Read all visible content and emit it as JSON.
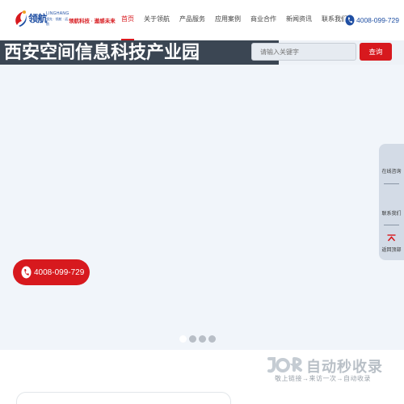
{
  "brand": {
    "name": "领航",
    "en": "LINGHANG",
    "sub": "领先 · 领航 · 远航",
    "slogan": "领航科技 · 遨感未来"
  },
  "nav": {
    "items": [
      "首页",
      "关于领航",
      "产品服务",
      "应用案例",
      "商业合作",
      "新闻资讯",
      "联系我们"
    ],
    "active_index": 0
  },
  "hotline": "4008-099-729",
  "banner": {
    "title": "西安空间信息科技产业园",
    "search_placeholder": "请输入关键字",
    "search_button": "查询",
    "phone": "4008-099-729",
    "slide_count": 4,
    "active_slide": 0
  },
  "float_bar": {
    "consult": "在线咨询",
    "contact": "联系我们",
    "back_top": "返回顶部"
  },
  "watermark": {
    "title": "自动秒收录",
    "subtitle": "敬上链接→来访一次→自动收录"
  },
  "colors": {
    "accent": "#d7191e",
    "brand_blue": "#1f4fa3",
    "banner_bg": "#f1f5fa",
    "title_strip": "#3b4653"
  }
}
